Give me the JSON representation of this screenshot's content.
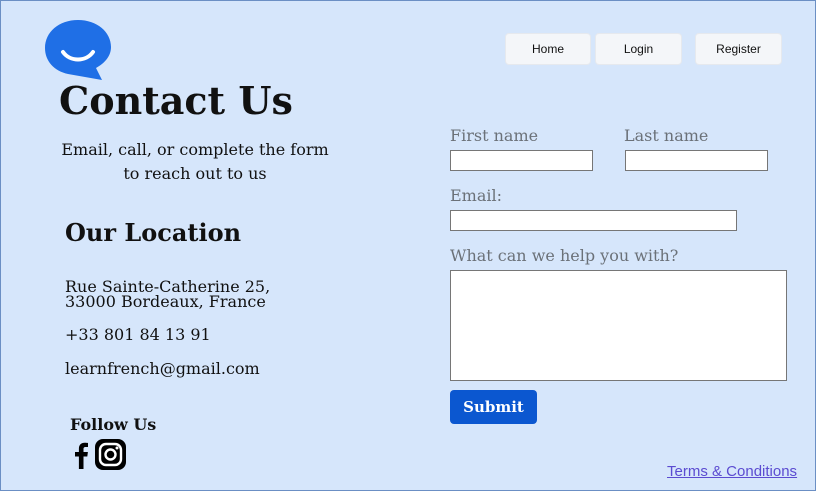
{
  "brand": {
    "logo_icon": "chat-bubble-smile-icon",
    "logo_color": "#1f6fe6"
  },
  "nav": {
    "home_label": "Home",
    "login_label": "Login",
    "register_label": "Register"
  },
  "contact": {
    "title": "Contact Us",
    "subtitle": "Email, call, or complete the form to reach out to us"
  },
  "location": {
    "title": "Our Location",
    "address": "Rue Sainte-Catherine 25, 33000 Bordeaux, France",
    "phone": "+33 801 84 13 91",
    "email": "learnfrench@gmail.com"
  },
  "social": {
    "title": "Follow Us",
    "icons": [
      "facebook-icon",
      "instagram-icon"
    ]
  },
  "form": {
    "first_name_label": "First name",
    "last_name_label": "Last name",
    "email_label": "Email:",
    "help_label": "What can we help you with?",
    "first_name_value": "",
    "last_name_value": "",
    "email_value": "",
    "help_value": "",
    "submit_label": "Submit",
    "submit_color": "#0b57d0"
  },
  "footer": {
    "terms_label": "Terms & Conditions"
  }
}
